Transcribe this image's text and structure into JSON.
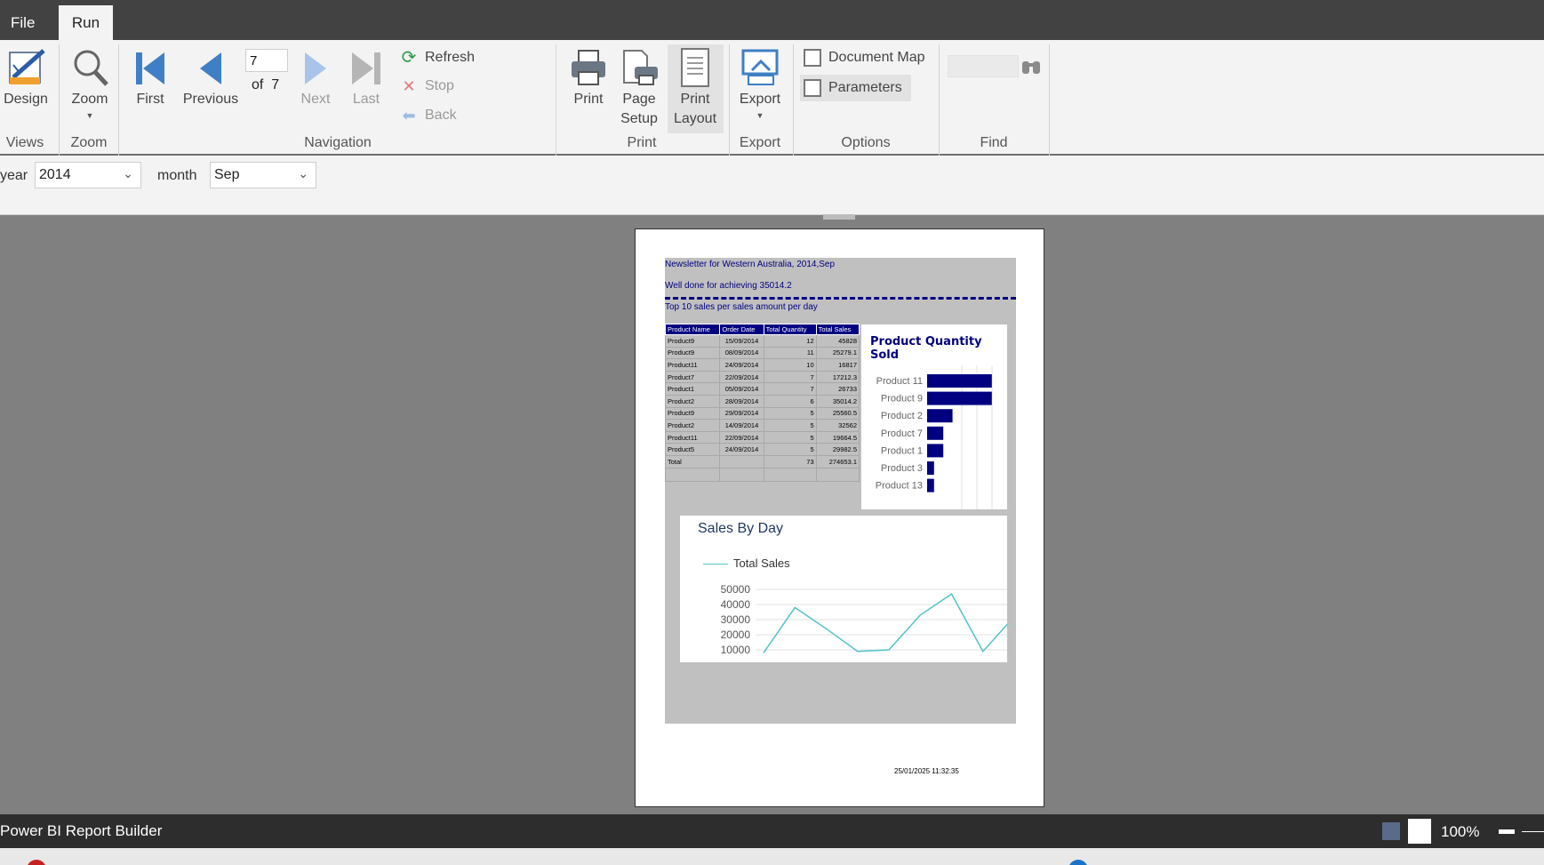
{
  "tabs": {
    "file": "File",
    "run": "Run"
  },
  "ribbon": {
    "views": {
      "design": "Design",
      "group": "Views"
    },
    "zoom": {
      "zoom": "Zoom",
      "group": "Zoom"
    },
    "navigation": {
      "first": "First",
      "previous": "Previous",
      "page_value": "7",
      "of_label": "of",
      "page_count": "7",
      "next": "Next",
      "last": "Last",
      "refresh": "Refresh",
      "stop": "Stop",
      "back": "Back",
      "group": "Navigation"
    },
    "print": {
      "print": "Print",
      "page_setup_1": "Page",
      "page_setup_2": "Setup",
      "print_layout_1": "Print",
      "print_layout_2": "Layout",
      "group": "Print"
    },
    "export": {
      "export": "Export",
      "group": "Export"
    },
    "options": {
      "document_map": "Document Map",
      "parameters": "Parameters",
      "group": "Options"
    },
    "find": {
      "group": "Find"
    }
  },
  "params": {
    "year_label": "year",
    "year_value": "2014",
    "month_label": "month",
    "month_value": "Sep"
  },
  "report": {
    "heading": "Newsletter for Western Australia, 2014,Sep",
    "congrats": "Well done for achieving 35014.2",
    "subheading": "Top 10 sales per sales amount per day",
    "table": {
      "headers": [
        "Product Name",
        "Order Date",
        "Total Quantity",
        "Total Sales"
      ],
      "rows": [
        [
          "Product9",
          "15/09/2014",
          "12",
          "45828"
        ],
        [
          "Product9",
          "08/09/2014",
          "11",
          "25279.1"
        ],
        [
          "Product11",
          "24/09/2014",
          "10",
          "16817"
        ],
        [
          "Product7",
          "22/09/2014",
          "7",
          "17212.3"
        ],
        [
          "Product1",
          "05/09/2014",
          "7",
          "26733"
        ],
        [
          "Product2",
          "28/09/2014",
          "6",
          "35014.2"
        ],
        [
          "Product9",
          "29/09/2014",
          "5",
          "25560.5"
        ],
        [
          "Product2",
          "14/09/2014",
          "5",
          "32562"
        ],
        [
          "Product11",
          "22/09/2014",
          "5",
          "19664.5"
        ],
        [
          "Product5",
          "24/09/2014",
          "5",
          "29982.5"
        ]
      ],
      "total_label": "Total",
      "total_quantity": "73",
      "total_sales": "274653.1"
    },
    "timestamp": "25/01/2025 11:32:35"
  },
  "chart_data": [
    {
      "type": "bar",
      "title": "Product Quantity Sold",
      "categories": [
        "Product 11",
        "Product 9",
        "Product 2",
        "Product 7",
        "Product 1",
        "Product 3",
        "Product 13"
      ],
      "values": [
        28,
        28,
        11,
        7,
        7,
        3,
        3
      ],
      "color": "#000080"
    },
    {
      "type": "line",
      "title": "Sales By Day",
      "series": [
        {
          "name": "Total Sales",
          "values": [
            8000,
            38000,
            24000,
            9000,
            10000,
            33000,
            47000,
            9000,
            32000
          ]
        }
      ],
      "y_ticks": [
        "50000",
        "40000",
        "30000",
        "20000",
        "10000"
      ],
      "ylim": [
        0,
        50000
      ],
      "color": "#4fc3c9"
    }
  ],
  "status": {
    "app_title": "Power BI Report Builder",
    "zoom": "100%"
  }
}
